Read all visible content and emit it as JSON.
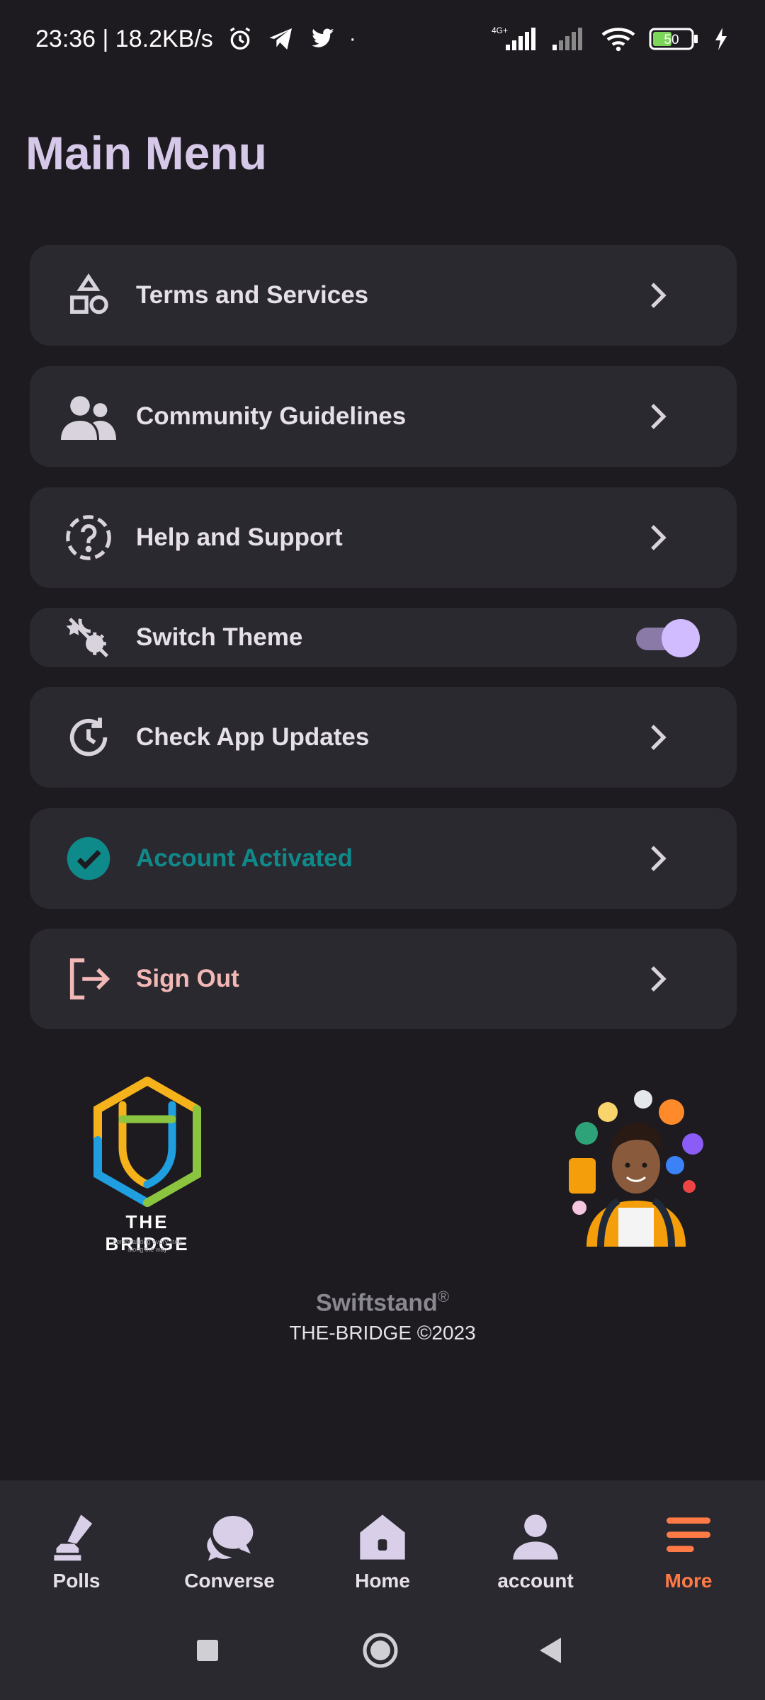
{
  "status_bar": {
    "time_speed": "23:36 | 18.2KB/s",
    "network_label": "4G+",
    "battery": "50"
  },
  "page_title": "Main Menu",
  "menu": {
    "terms": "Terms and Services",
    "community": "Community Guidelines",
    "help": "Help and Support",
    "theme": "Switch Theme",
    "updates": "Check App Updates",
    "account": "Account Activated",
    "signout": "Sign Out"
  },
  "theme_toggle": {
    "on": true
  },
  "logo": {
    "name": "THE BRIDGE",
    "tagline_1": "personalizing every step",
    "tagline_2": "along the way"
  },
  "footer": {
    "brand": "Swiftstand",
    "registered": "®",
    "copyright": "THE-BRIDGE ©2023"
  },
  "bottom_nav": {
    "polls": "Polls",
    "converse": "Converse",
    "home": "Home",
    "account": "account",
    "more": "More"
  },
  "colors": {
    "background": "#1d1b20",
    "card": "#2b2930",
    "accent_purple": "#d0bcff",
    "teal": "#0f8a8a",
    "signout_pink": "#f2b8b5",
    "active_orange": "#ff7a45"
  }
}
